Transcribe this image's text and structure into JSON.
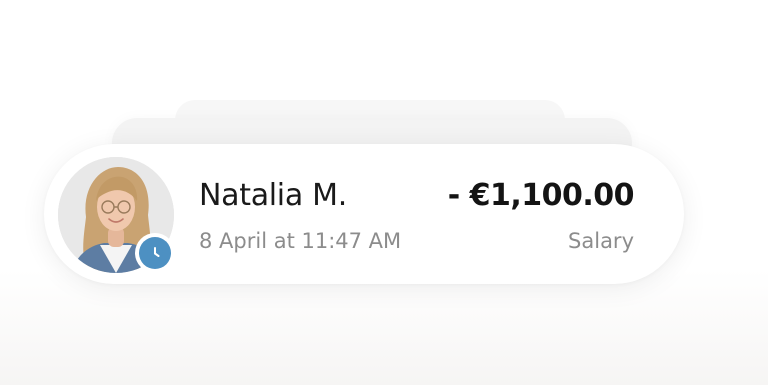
{
  "transaction": {
    "name": "Natalia M.",
    "amount": "- €1,100.00",
    "timestamp": "8 April at 11:47 AM",
    "category": "Salary",
    "status_icon": "clock-icon",
    "avatar_icon": "user-photo"
  },
  "colors": {
    "status_badge": "#4d90c2",
    "primary_text": "#1a1a1a",
    "secondary_text": "#8c8c8c"
  }
}
